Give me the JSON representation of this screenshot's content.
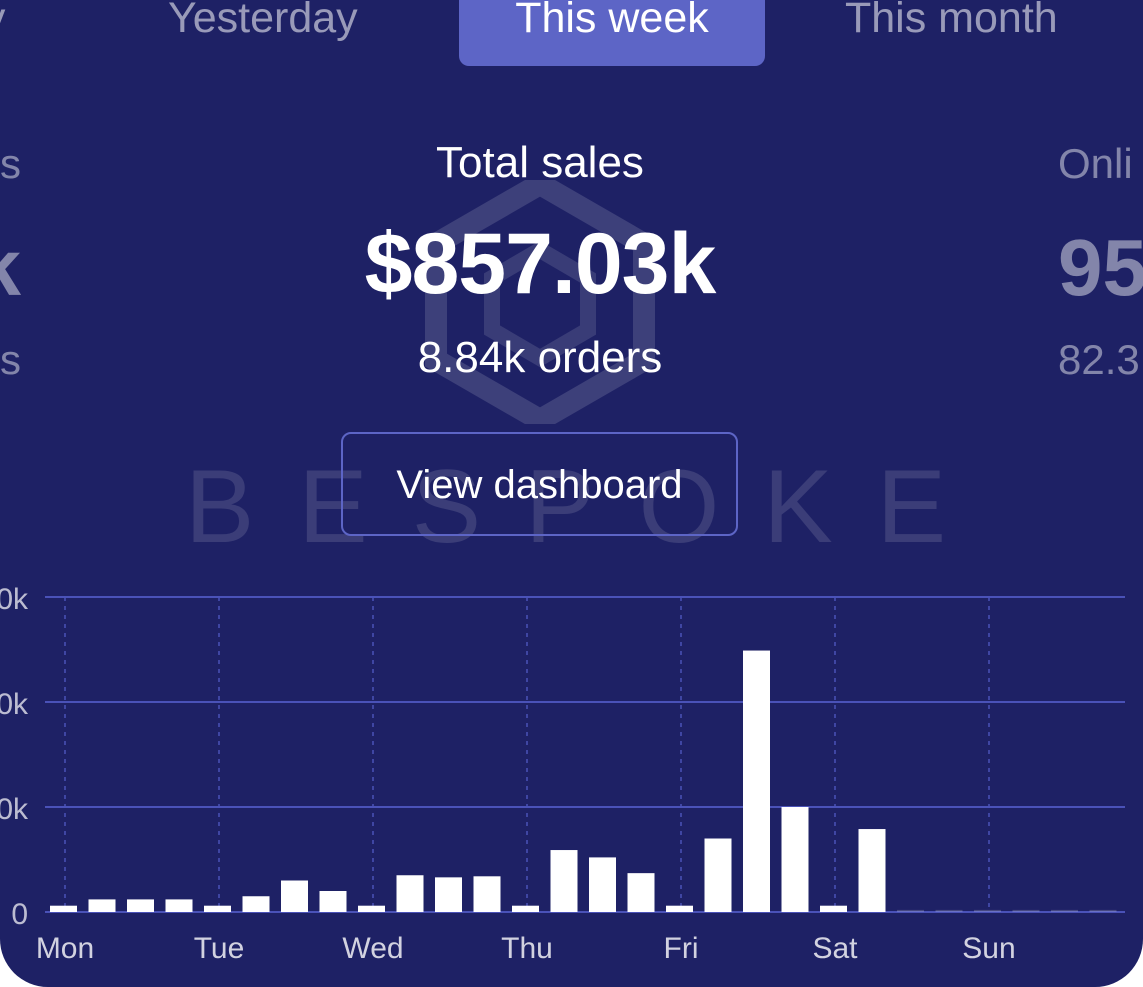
{
  "tabs": [
    {
      "label": "Today",
      "visible_text": "ay",
      "active": false
    },
    {
      "label": "Yesterday",
      "active": false
    },
    {
      "label": "This week",
      "active": true
    },
    {
      "label": "This month",
      "active": false
    }
  ],
  "metrics": {
    "left": {
      "title": "s",
      "value": "k",
      "sub": "s"
    },
    "main": {
      "title": "Total sales",
      "value": "$857.03k",
      "sub": "8.84k orders"
    },
    "right": {
      "title": "Onli",
      "value": "95",
      "sub": "82.3"
    }
  },
  "dashboard_button": {
    "label": "View dashboard"
  },
  "watermark": {
    "text": "BESPOKE"
  },
  "colors": {
    "background": "#1e2165",
    "accent": "#5d65c6",
    "gridline": "#4a52b8",
    "bar": "#ffffff"
  },
  "chart_data": {
    "type": "bar",
    "y_tick_labels": [
      "0",
      "0k",
      "0k",
      "0k"
    ],
    "ylim": [
      0,
      300
    ],
    "yticks": [
      0,
      100,
      200,
      300
    ],
    "grid": true,
    "x_labels": [
      "Mon",
      "Tue",
      "Wed",
      "Thu",
      "Fri",
      "Sat",
      "Sun"
    ],
    "bars_per_day": 4,
    "values": [
      6,
      12,
      12,
      12,
      6,
      15,
      30,
      20,
      6,
      35,
      33,
      34,
      6,
      59,
      52,
      37,
      6,
      70,
      249,
      100,
      6,
      79,
      2,
      2,
      2,
      2,
      2,
      2
    ]
  }
}
